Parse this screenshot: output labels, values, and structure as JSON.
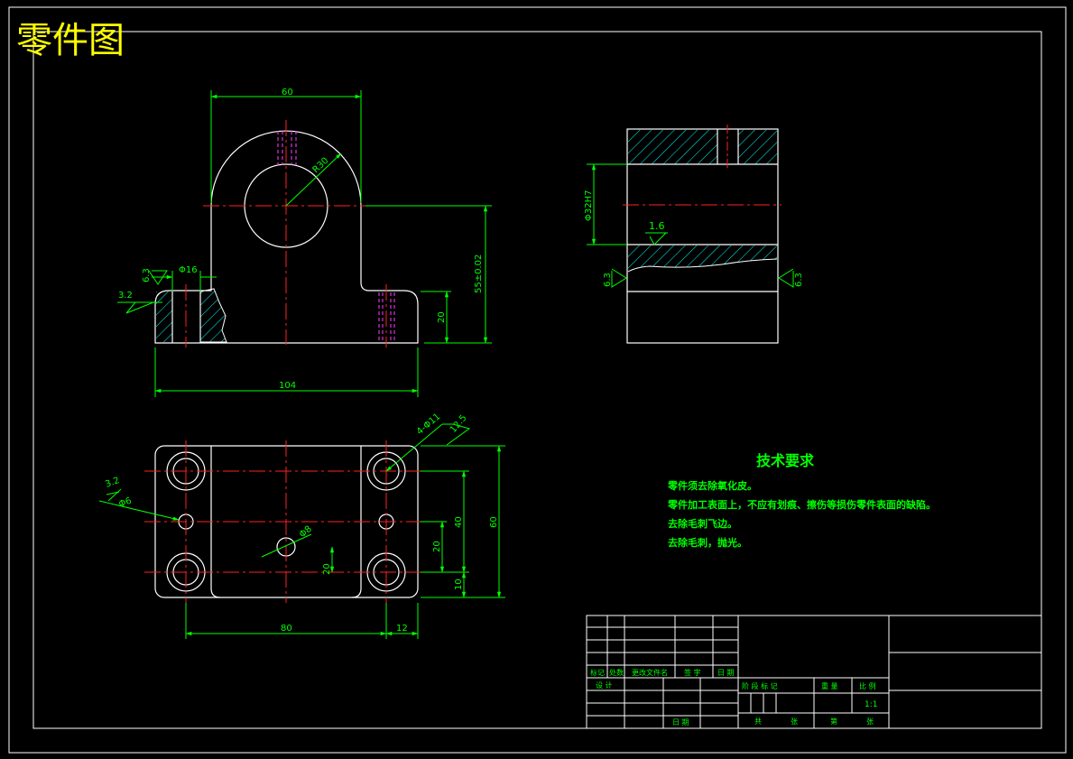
{
  "header": {
    "title": "零件图"
  },
  "colors": {
    "outline": "#ffffff",
    "dimension": "#00ff00",
    "centerline": "#ff2020",
    "hidden": "#ff40ff",
    "hatch": "#00ffff",
    "title_text": "#ffff00",
    "notes_text": "#00ff00",
    "background": "#000000"
  },
  "front_view": {
    "dim_width": "60",
    "dim_radius": "R30",
    "dim_hole": "Φ16",
    "dim_base_length": "104",
    "dim_height_center": "55±0.02",
    "dim_base_height": "20",
    "rough_left_top": "6.3",
    "rough_left_side": "3.2"
  },
  "side_view": {
    "dim_bore": "Φ32H7",
    "rough_bore": "1.6",
    "rough_left": "6.3",
    "rough_right": "6.3"
  },
  "top_view": {
    "dim_holes": "4-Φ11",
    "rough_holes": "12.5",
    "rough_pin": "3.2",
    "dim_pin": "Φ6",
    "dim_center_hole": "Φ8",
    "dim_center_spacing": "80",
    "dim_edge_12": "12",
    "dim_40": "40",
    "dim_60": "60",
    "dim_20a": "20",
    "dim_20b": "20",
    "dim_10": "10"
  },
  "notes": {
    "heading": "技术要求",
    "items": [
      "零件须去除氧化皮。",
      "零件加工表面上，不应有划痕、擦伤等损伤零件表面的缺陷。",
      "去除毛刺飞边。",
      "去除毛刺，抛光。"
    ]
  },
  "title_block": {
    "rev_headers": [
      "标记",
      "处数",
      "更改文件名",
      "签 字",
      "日 期"
    ],
    "design_label": "设 计",
    "date_label": "日 期",
    "stage_label": "阶 段 标 记",
    "weight_label": "重 量",
    "scale_label": "比 例",
    "scale_value": "1:1",
    "sheet_total": "共",
    "sheet_unit_1": "张",
    "sheet_no": "第",
    "sheet_unit_2": "张"
  }
}
